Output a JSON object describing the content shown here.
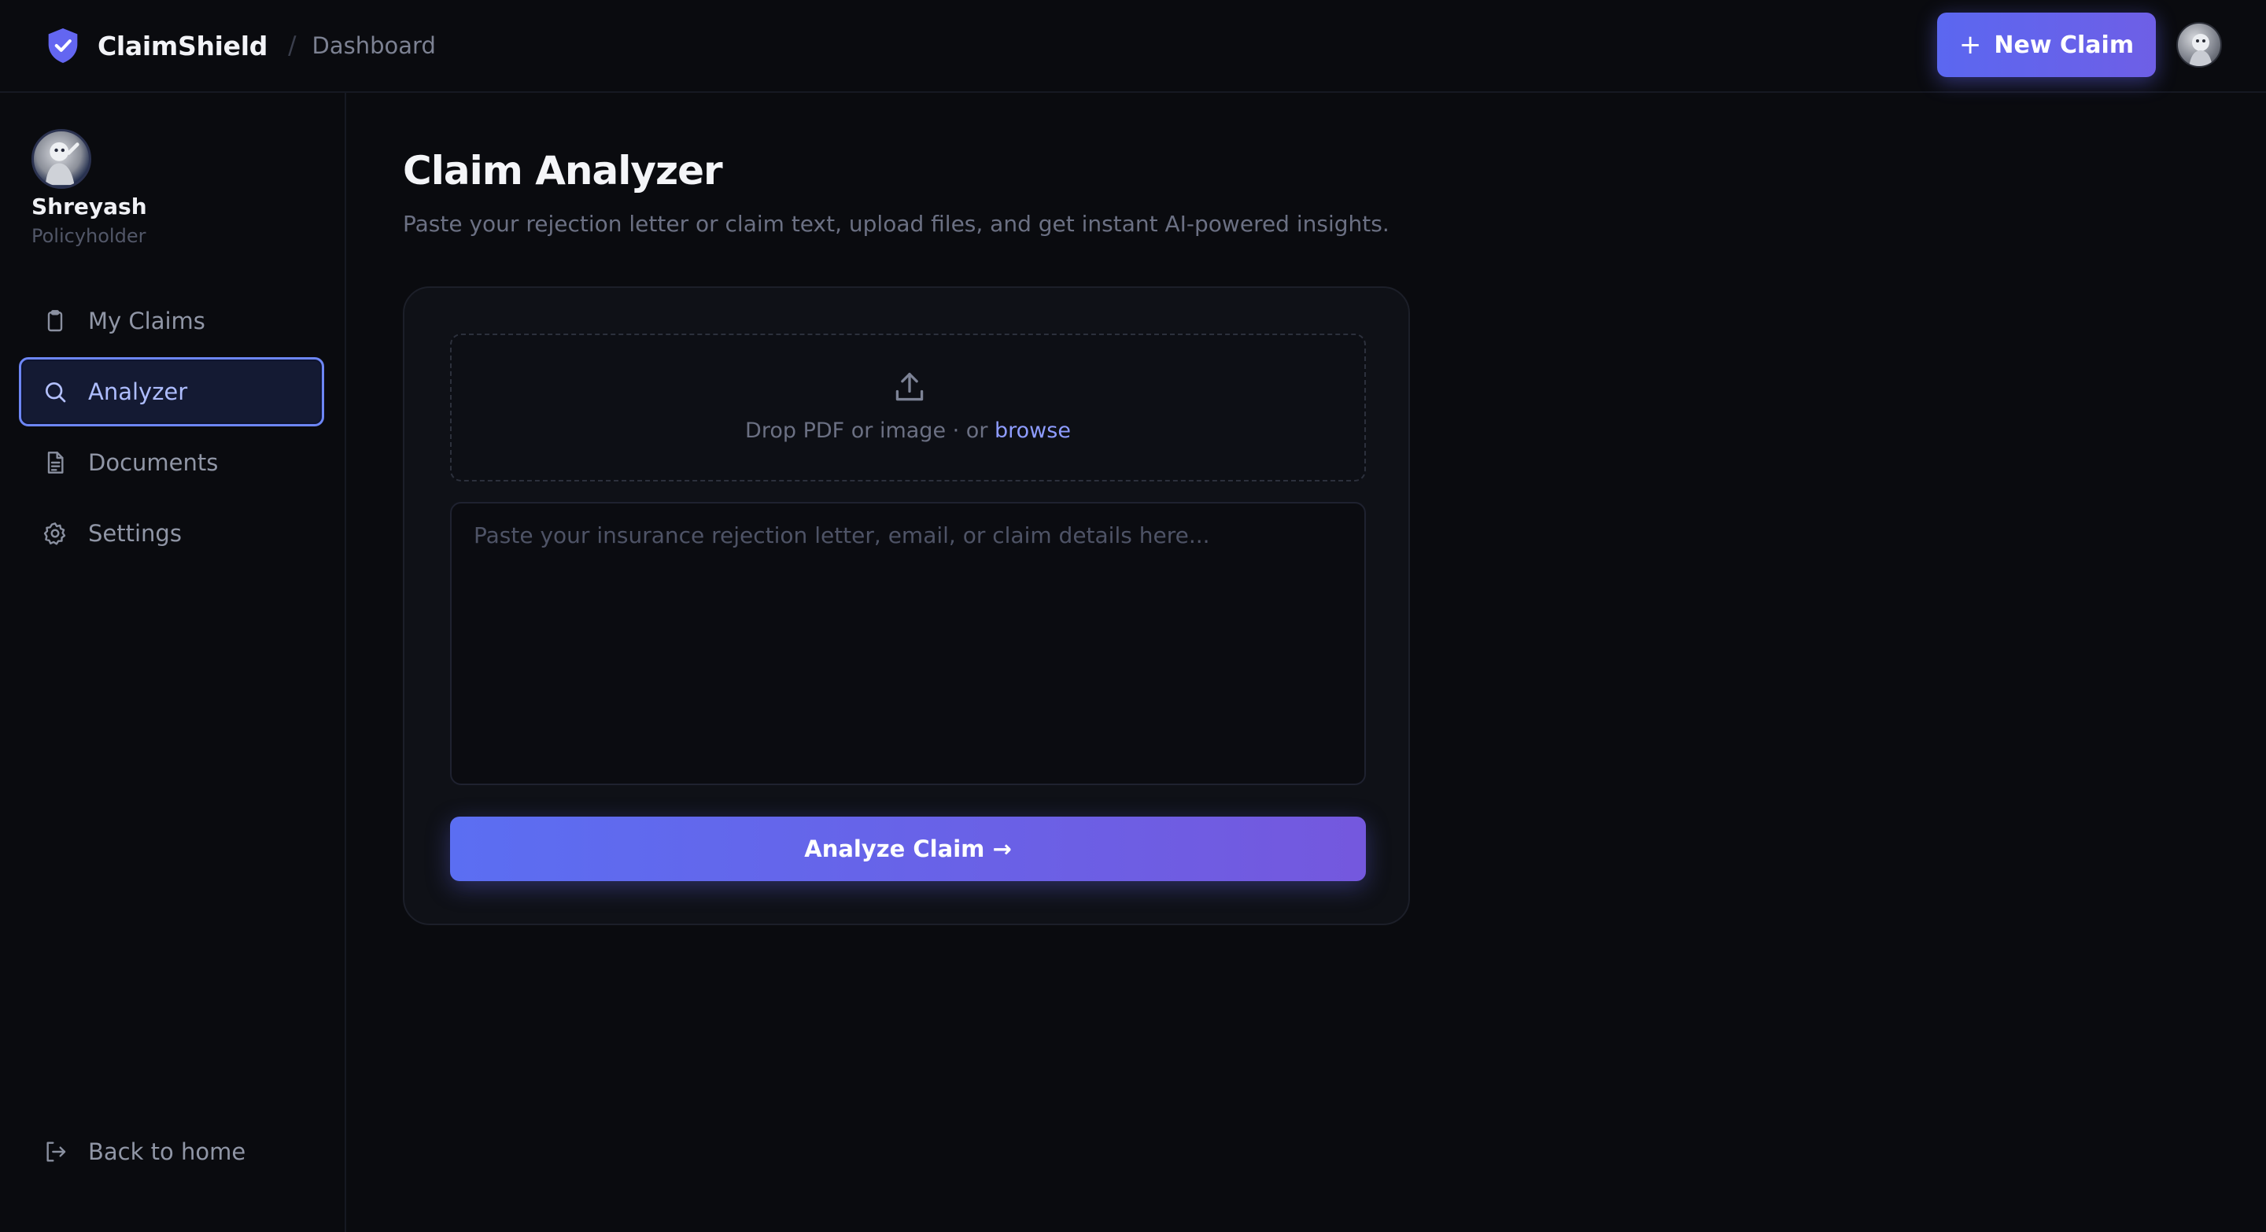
{
  "header": {
    "brand": "ClaimShield",
    "separator": "/",
    "breadcrumb": "Dashboard",
    "new_claim_plus": "+",
    "new_claim_label": "New Claim"
  },
  "sidebar": {
    "user": {
      "name": "Shreyash",
      "role": "Policyholder"
    },
    "items": [
      {
        "label": "My Claims",
        "icon": "clipboard-icon",
        "active": false
      },
      {
        "label": "Analyzer",
        "icon": "search-icon",
        "active": true
      },
      {
        "label": "Documents",
        "icon": "document-icon",
        "active": false
      },
      {
        "label": "Settings",
        "icon": "gear-icon",
        "active": false
      }
    ],
    "back_home": "Back to home"
  },
  "main": {
    "title": "Claim Analyzer",
    "subtitle": "Paste your rejection letter or claim text, upload files, and get instant AI-powered insights.",
    "dropzone": {
      "text": "Drop PDF or image · or ",
      "link": "browse"
    },
    "textarea_placeholder": "Paste your insurance rejection letter, email, or claim details here...",
    "analyze_label": "Analyze Claim →"
  },
  "colors": {
    "accent": "#6366f1",
    "background": "#0a0b0f",
    "active_border": "#6d86f5"
  }
}
